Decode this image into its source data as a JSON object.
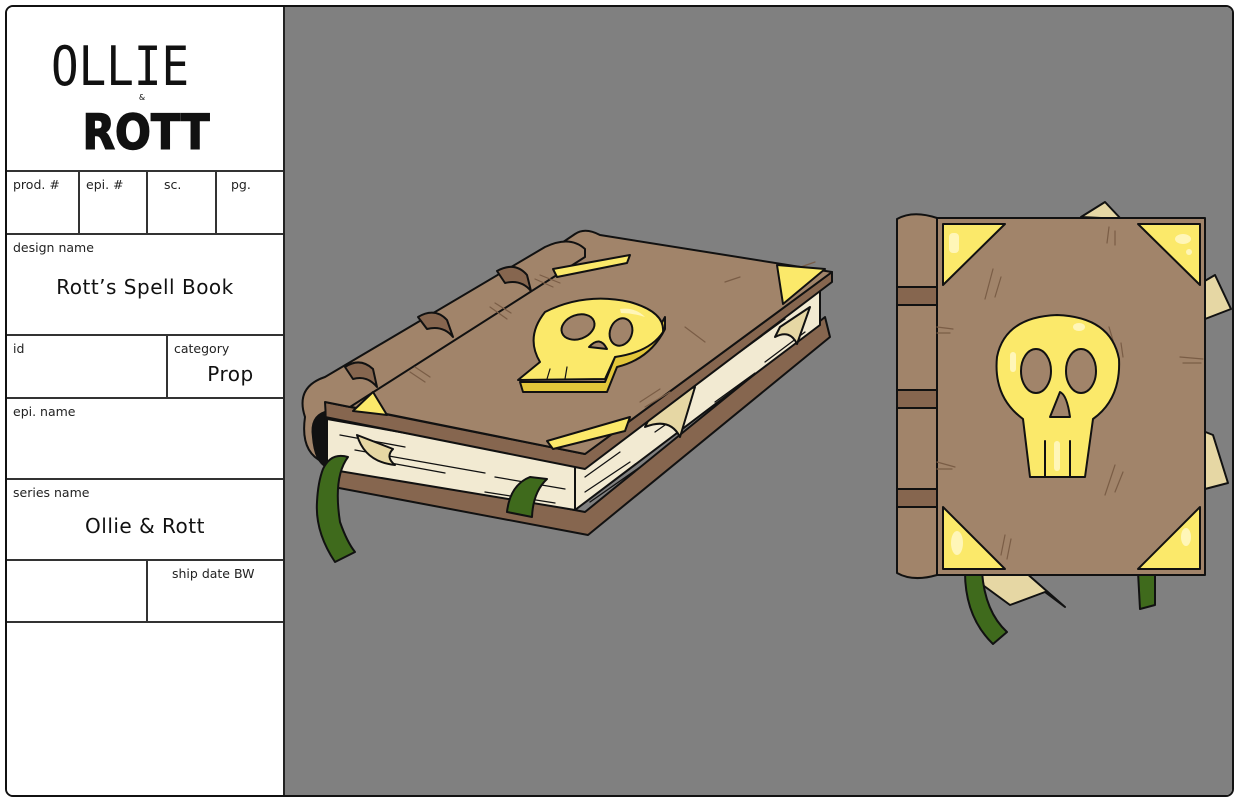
{
  "sheet": {
    "logo": {
      "line1": "OLLIE",
      "amp": "&",
      "line2": "ROTT"
    },
    "fields": {
      "prod_no": {
        "label": "prod. #",
        "value": ""
      },
      "epi_no": {
        "label": "epi. #",
        "value": ""
      },
      "scene": {
        "label": "sc.",
        "value": ""
      },
      "page": {
        "label": "pg.",
        "value": ""
      },
      "design_name": {
        "label": "design name",
        "value": "Rott’s Spell Book"
      },
      "id": {
        "label": "id",
        "value": ""
      },
      "category": {
        "label": "category",
        "value": "Prop"
      },
      "epi_name": {
        "label": "epi. name",
        "value": ""
      },
      "series_name": {
        "label": "series name",
        "value": "Ollie & Rott"
      },
      "blank": {
        "label": "",
        "value": ""
      },
      "ship_date": {
        "label": "ship date BW",
        "value": ""
      }
    }
  },
  "artwork": {
    "subject": "spell book prop with gold skull emblem",
    "views": [
      "three-quarter view",
      "front view"
    ],
    "colors": {
      "background": "#808080",
      "leather": "#a1846a",
      "leather_dark": "#86664f",
      "pages": "#f2ead2",
      "page_tab": "#e6d7a4",
      "gold": "#fbe96a",
      "gold_dark": "#e3c73a",
      "gold_highlight": "#fff6b8",
      "ribbon": "#3f6a1c",
      "outline": "#111111"
    }
  }
}
